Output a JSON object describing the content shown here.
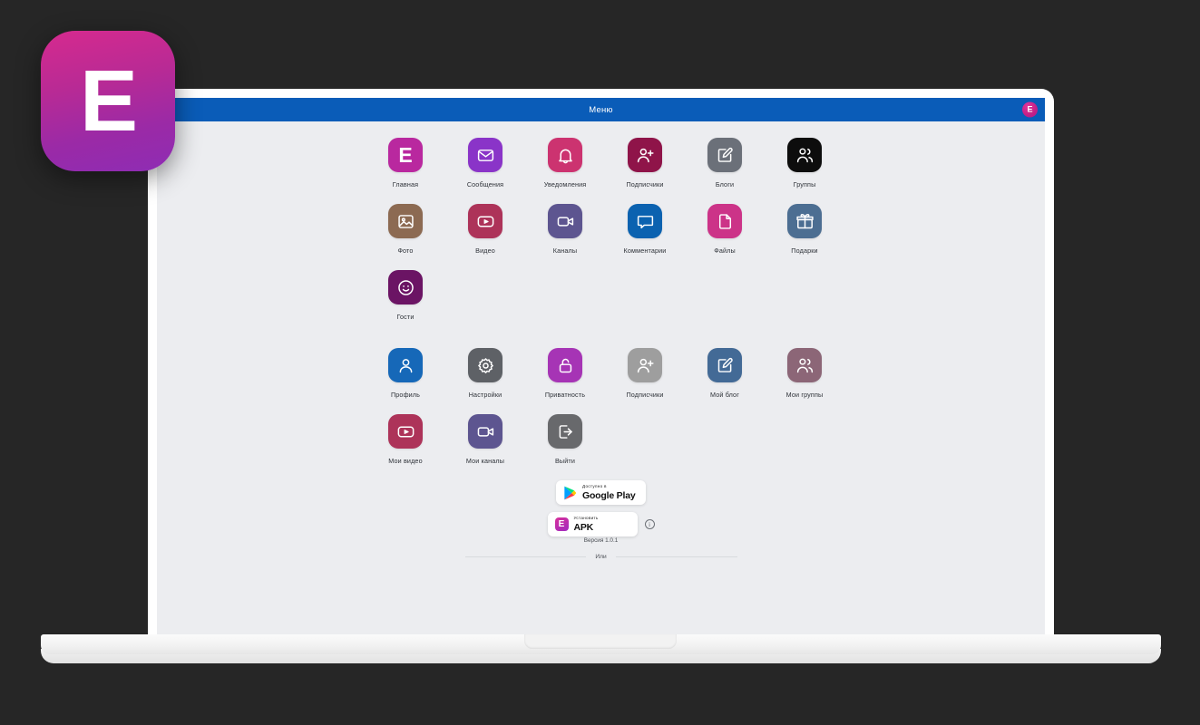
{
  "app": {
    "logo_letter": "E",
    "logo_gradient_from": "#d62a8e",
    "logo_gradient_to": "#8e2cb4"
  },
  "topbar": {
    "title": "Меню",
    "avatar_letter": "E",
    "background": "#0a5cb8"
  },
  "menu": {
    "rows": [
      [
        {
          "label": "Главная",
          "icon": "logo-e-icon",
          "color": "#b9289f"
        },
        {
          "label": "Сообщения",
          "icon": "envelope-icon",
          "color": "#8a34c8"
        },
        {
          "label": "Уведомления",
          "icon": "bell-icon",
          "color": "#cc3370"
        },
        {
          "label": "Подписчики",
          "icon": "user-plus-icon",
          "color": "#8f1449"
        },
        {
          "label": "Блоги",
          "icon": "edit-square-icon",
          "color": "#6b7079"
        },
        {
          "label": "Группы",
          "icon": "users-icon",
          "color": "#0d0d0d"
        }
      ],
      [
        {
          "label": "Фото",
          "icon": "image-icon",
          "color": "#8c6a52"
        },
        {
          "label": "Видео",
          "icon": "video-play-icon",
          "color": "#ad3359"
        },
        {
          "label": "Каналы",
          "icon": "camcorder-icon",
          "color": "#5d5590"
        },
        {
          "label": "Комментарии",
          "icon": "chat-bubble-icon",
          "color": "#0b62b0"
        },
        {
          "label": "Файлы",
          "icon": "file-icon",
          "color": "#cc3388"
        },
        {
          "label": "Подарки",
          "icon": "gift-icon",
          "color": "#4c6e92"
        }
      ],
      [
        {
          "label": "Гости",
          "icon": "smiley-icon",
          "color": "#6b1464"
        }
      ]
    ],
    "rows_personal": [
      [
        {
          "label": "Профиль",
          "icon": "user-icon",
          "color": "#1668b8"
        },
        {
          "label": "Настройки",
          "icon": "gear-icon",
          "color": "#5e6166"
        },
        {
          "label": "Приватность",
          "icon": "unlock-icon",
          "color": "#a634b5"
        },
        {
          "label": "Подписчики",
          "icon": "user-plus-icon",
          "color": "#9e9e9e"
        },
        {
          "label": "Мой блог",
          "icon": "edit-square-icon",
          "color": "#436a96"
        },
        {
          "label": "Мои группы",
          "icon": "users-icon",
          "color": "#8c6677"
        }
      ],
      [
        {
          "label": "Мои видео",
          "icon": "video-play-icon",
          "color": "#ad3359"
        },
        {
          "label": "Мои каналы",
          "icon": "camcorder-icon",
          "color": "#5d5590"
        },
        {
          "label": "Выйти",
          "icon": "logout-icon",
          "color": "#68696c"
        }
      ]
    ]
  },
  "store": {
    "google_play": {
      "sub": "Доступно в",
      "main": "Google Play",
      "icon": "google-play-icon"
    },
    "apk": {
      "sub": "Установить",
      "main": "APK",
      "icon": "apk-logo-icon"
    },
    "info_glyph": "i",
    "version": "Версия 1.0.1",
    "divider_text": "Или"
  }
}
